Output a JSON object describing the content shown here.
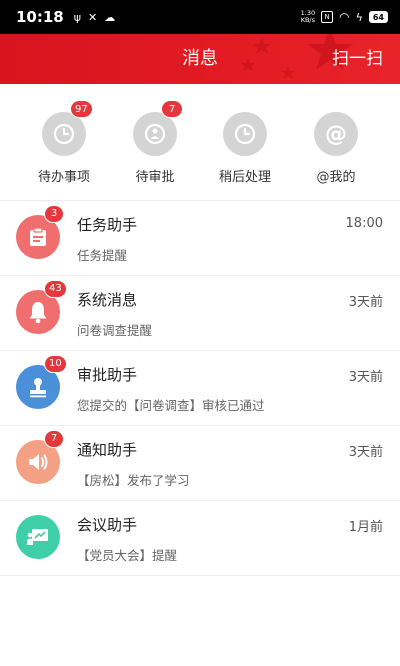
{
  "status_bar": {
    "time": "10:18",
    "left_icons": [
      "usb-icon",
      "tools-icon",
      "cloud-icon"
    ],
    "net_speed_value": "1.30",
    "net_speed_unit": "KB/s",
    "battery": "64"
  },
  "header": {
    "title": "消息",
    "scan_label": "扫一扫",
    "accent_color": "#e31b23"
  },
  "quick_actions": [
    {
      "label": "待办事项",
      "badge": "97",
      "icon": "clock-icon"
    },
    {
      "label": "待审批",
      "badge": "7",
      "icon": "clock-person-icon"
    },
    {
      "label": "稍后处理",
      "badge": "",
      "icon": "clock-icon"
    },
    {
      "label": "@我的",
      "badge": "",
      "icon": "at-icon"
    }
  ],
  "messages": [
    {
      "title": "任务助手",
      "subtitle": "任务提醒",
      "time": "18:00",
      "badge": "3",
      "icon": "clipboard-icon",
      "color": "#f06e6e"
    },
    {
      "title": "系统消息",
      "subtitle": "问卷调查提醒",
      "time": "3天前",
      "badge": "43",
      "icon": "bell-icon",
      "color": "#f06e6e"
    },
    {
      "title": "审批助手",
      "subtitle": "您提交的【问卷调查】审核已通过",
      "time": "3天前",
      "badge": "10",
      "icon": "stamp-icon",
      "color": "#4a90d9"
    },
    {
      "title": "通知助手",
      "subtitle": "【房松】发布了学习",
      "time": "3天前",
      "badge": "7",
      "icon": "speaker-icon",
      "color": "#f4a084"
    },
    {
      "title": "会议助手",
      "subtitle": "【党员大会】提醒",
      "time": "1月前",
      "badge": "",
      "icon": "presentation-icon",
      "color": "#3fcfa8"
    }
  ]
}
